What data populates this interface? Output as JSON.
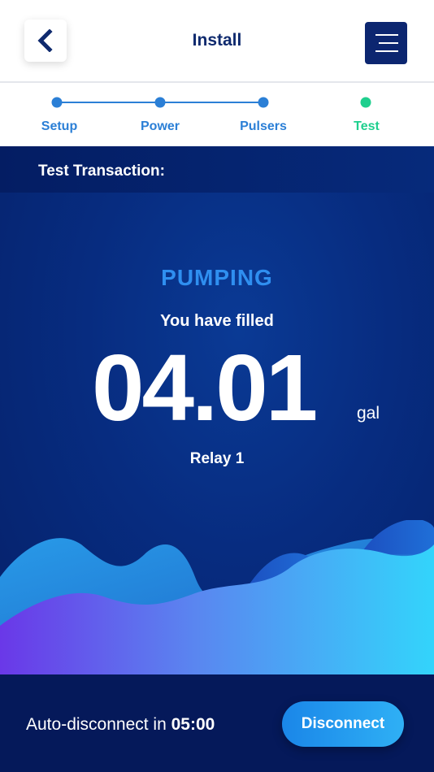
{
  "header": {
    "title": "Install",
    "back_icon": "chevron-left-icon",
    "menu_icon": "hamburger-menu-icon"
  },
  "stepper": {
    "steps": [
      {
        "label": "Setup",
        "state": "completed"
      },
      {
        "label": "Power",
        "state": "completed"
      },
      {
        "label": "Pulsers",
        "state": "completed"
      },
      {
        "label": "Test",
        "state": "active"
      }
    ],
    "colors": {
      "completed": "#2b7fd6",
      "active": "#1fcf8e"
    }
  },
  "transaction": {
    "title": "Test Transaction:",
    "status": "PUMPING",
    "filled_label": "You have filled",
    "amount": "04.01",
    "unit": "gal",
    "relay": "Relay 1"
  },
  "footer": {
    "countdown_label": "Auto-disconnect in ",
    "countdown_time": "05:00",
    "disconnect_label": "Disconnect"
  }
}
